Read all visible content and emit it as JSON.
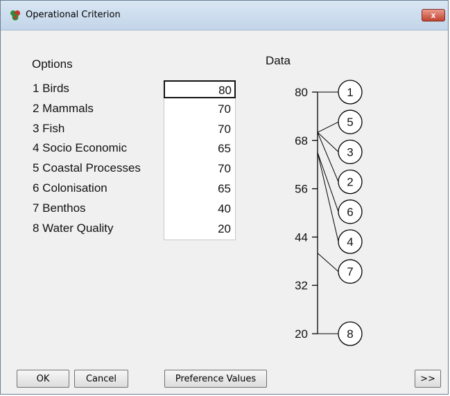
{
  "window": {
    "title": "Operational Criterion",
    "close_glyph": "x"
  },
  "headers": {
    "options": "Options",
    "data": "Data"
  },
  "options": [
    {
      "num": "1",
      "name": "Birds",
      "value": "80"
    },
    {
      "num": "2",
      "name": "Mammals",
      "value": "70"
    },
    {
      "num": "3",
      "name": "Fish",
      "value": "70"
    },
    {
      "num": "4",
      "name": "Socio Economic",
      "value": "65"
    },
    {
      "num": "5",
      "name": "Coastal Processes",
      "value": "70"
    },
    {
      "num": "6",
      "name": "Colonisation",
      "value": "65"
    },
    {
      "num": "7",
      "name": "Benthos",
      "value": "40"
    },
    {
      "num": "8",
      "name": "Water Quality",
      "value": "20"
    }
  ],
  "scale": {
    "ticks": [
      "80",
      "68",
      "56",
      "44",
      "32",
      "20"
    ],
    "min": 20,
    "max": 80,
    "node_order": [
      "1",
      "5",
      "3",
      "2",
      "6",
      "4",
      "7",
      "8"
    ]
  },
  "buttons": {
    "ok": "OK",
    "cancel": "Cancel",
    "preference": "Preference Values",
    "more": ">>"
  },
  "colors": {
    "icon_green": "#2e8b3a",
    "icon_red": "#c0392b",
    "close_red": "#c1432f"
  }
}
